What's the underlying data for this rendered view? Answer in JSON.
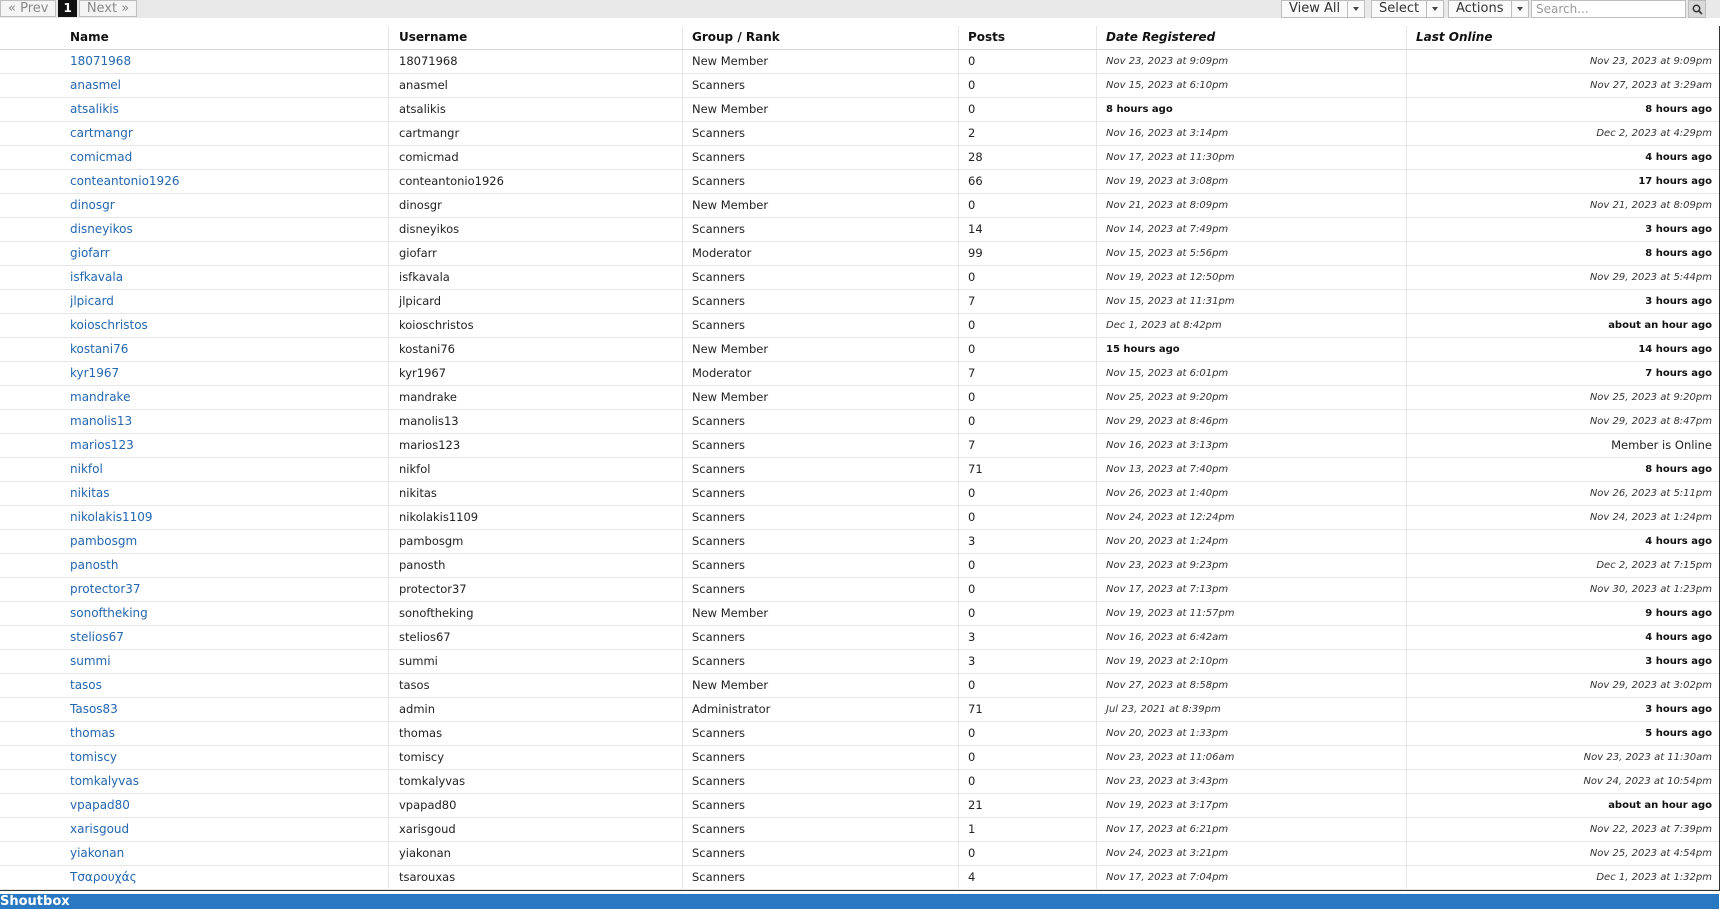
{
  "pager": {
    "prev": "« Prev",
    "current": "1",
    "next": "Next »"
  },
  "controls": {
    "view_all": "View All",
    "select": "Select",
    "actions": "Actions",
    "search_placeholder": "Search..."
  },
  "columns": [
    "Name",
    "Username",
    "Group / Rank",
    "Posts",
    "Date Registered",
    "Last Online"
  ],
  "rows": [
    {
      "name": "18071968",
      "username": "18071968",
      "group": "New Member",
      "posts": "0",
      "registered": "Nov 23, 2023 at 9:09pm",
      "last": "Nov 23, 2023 at 9:09pm"
    },
    {
      "name": "anasmel",
      "username": "anasmel",
      "group": "Scanners",
      "posts": "0",
      "registered": "Nov 15, 2023 at 6:10pm",
      "last": "Nov 27, 2023 at 3:29am"
    },
    {
      "name": "atsalikis",
      "username": "atsalikis",
      "group": "New Member",
      "posts": "0",
      "registered": "8 hours ago",
      "last": "8 hours ago"
    },
    {
      "name": "cartmangr",
      "username": "cartmangr",
      "group": "Scanners",
      "posts": "2",
      "registered": "Nov 16, 2023 at 3:14pm",
      "last": "Dec 2, 2023 at 4:29pm"
    },
    {
      "name": "comicmad",
      "username": "comicmad",
      "group": "Scanners",
      "posts": "28",
      "registered": "Nov 17, 2023 at 11:30pm",
      "last": "4 hours ago"
    },
    {
      "name": "conteantonio1926",
      "username": "conteantonio1926",
      "group": "Scanners",
      "posts": "66",
      "registered": "Nov 19, 2023 at 3:08pm",
      "last": "17 hours ago"
    },
    {
      "name": "dinosgr",
      "username": "dinosgr",
      "group": "New Member",
      "posts": "0",
      "registered": "Nov 21, 2023 at 8:09pm",
      "last": "Nov 21, 2023 at 8:09pm"
    },
    {
      "name": "disneyikos",
      "username": "disneyikos",
      "group": "Scanners",
      "posts": "14",
      "registered": "Nov 14, 2023 at 7:49pm",
      "last": "3 hours ago"
    },
    {
      "name": "giofarr",
      "username": "giofarr",
      "group": "Moderator",
      "posts": "99",
      "registered": "Nov 15, 2023 at 5:56pm",
      "last": "8 hours ago"
    },
    {
      "name": "isfkavala",
      "username": "isfkavala",
      "group": "Scanners",
      "posts": "0",
      "registered": "Nov 19, 2023 at 12:50pm",
      "last": "Nov 29, 2023 at 5:44pm"
    },
    {
      "name": "jlpicard",
      "username": "jlpicard",
      "group": "Scanners",
      "posts": "7",
      "registered": "Nov 15, 2023 at 11:31pm",
      "last": "3 hours ago"
    },
    {
      "name": "koioschristos",
      "username": "koioschristos",
      "group": "Scanners",
      "posts": "0",
      "registered": "Dec 1, 2023 at 8:42pm",
      "last": "about an hour ago"
    },
    {
      "name": "kostani76",
      "username": "kostani76",
      "group": "New Member",
      "posts": "0",
      "registered": "15 hours ago",
      "last": "14 hours ago"
    },
    {
      "name": "kyr1967",
      "username": "kyr1967",
      "group": "Moderator",
      "posts": "7",
      "registered": "Nov 15, 2023 at 6:01pm",
      "last": "7 hours ago"
    },
    {
      "name": "mandrake",
      "username": "mandrake",
      "group": "New Member",
      "posts": "0",
      "registered": "Nov 25, 2023 at 9:20pm",
      "last": "Nov 25, 2023 at 9:20pm"
    },
    {
      "name": "manolis13",
      "username": "manolis13",
      "group": "Scanners",
      "posts": "0",
      "registered": "Nov 29, 2023 at 8:46pm",
      "last": "Nov 29, 2023 at 8:47pm"
    },
    {
      "name": "marios123",
      "username": "marios123",
      "group": "Scanners",
      "posts": "7",
      "registered": "Nov 16, 2023 at 3:13pm",
      "last": "Member is Online"
    },
    {
      "name": "nikfol",
      "username": "nikfol",
      "group": "Scanners",
      "posts": "71",
      "registered": "Nov 13, 2023 at 7:40pm",
      "last": "8 hours ago"
    },
    {
      "name": "nikitas",
      "username": "nikitas",
      "group": "Scanners",
      "posts": "0",
      "registered": "Nov 26, 2023 at 1:40pm",
      "last": "Nov 26, 2023 at 5:11pm"
    },
    {
      "name": "nikolakis1109",
      "username": "nikolakis1109",
      "group": "Scanners",
      "posts": "0",
      "registered": "Nov 24, 2023 at 12:24pm",
      "last": "Nov 24, 2023 at 1:24pm"
    },
    {
      "name": "pambosgm",
      "username": "pambosgm",
      "group": "Scanners",
      "posts": "3",
      "registered": "Nov 20, 2023 at 1:24pm",
      "last": "4 hours ago"
    },
    {
      "name": "panosth",
      "username": "panosth",
      "group": "Scanners",
      "posts": "0",
      "registered": "Nov 23, 2023 at 9:23pm",
      "last": "Dec 2, 2023 at 7:15pm"
    },
    {
      "name": "protector37",
      "username": "protector37",
      "group": "Scanners",
      "posts": "0",
      "registered": "Nov 17, 2023 at 7:13pm",
      "last": "Nov 30, 2023 at 1:23pm"
    },
    {
      "name": "sonoftheking",
      "username": "sonoftheking",
      "group": "New Member",
      "posts": "0",
      "registered": "Nov 19, 2023 at 11:57pm",
      "last": "9 hours ago"
    },
    {
      "name": "stelios67",
      "username": "stelios67",
      "group": "Scanners",
      "posts": "3",
      "registered": "Nov 16, 2023 at 6:42am",
      "last": "4 hours ago"
    },
    {
      "name": "summi",
      "username": "summi",
      "group": "Scanners",
      "posts": "3",
      "registered": "Nov 19, 2023 at 2:10pm",
      "last": "3 hours ago"
    },
    {
      "name": "tasos",
      "username": "tasos",
      "group": "New Member",
      "posts": "0",
      "registered": "Nov 27, 2023 at 8:58pm",
      "last": "Nov 29, 2023 at 3:02pm"
    },
    {
      "name": "Tasos83",
      "username": "admin",
      "group": "Administrator",
      "posts": "71",
      "registered": "Jul 23, 2021 at 8:39pm",
      "last": "3 hours ago"
    },
    {
      "name": "thomas",
      "username": "thomas",
      "group": "Scanners",
      "posts": "0",
      "registered": "Nov 20, 2023 at 1:33pm",
      "last": "5 hours ago"
    },
    {
      "name": "tomiscy",
      "username": "tomiscy",
      "group": "Scanners",
      "posts": "0",
      "registered": "Nov 23, 2023 at 11:06am",
      "last": "Nov 23, 2023 at 11:30am"
    },
    {
      "name": "tomkalyvas",
      "username": "tomkalyvas",
      "group": "Scanners",
      "posts": "0",
      "registered": "Nov 23, 2023 at 3:43pm",
      "last": "Nov 24, 2023 at 10:54pm"
    },
    {
      "name": "vpapad80",
      "username": "vpapad80",
      "group": "Scanners",
      "posts": "21",
      "registered": "Nov 19, 2023 at 3:17pm",
      "last": "about an hour ago"
    },
    {
      "name": "xarisgoud",
      "username": "xarisgoud",
      "group": "Scanners",
      "posts": "1",
      "registered": "Nov 17, 2023 at 6:21pm",
      "last": "Nov 22, 2023 at 7:39pm"
    },
    {
      "name": "yiakonan",
      "username": "yiakonan",
      "group": "Scanners",
      "posts": "0",
      "registered": "Nov 24, 2023 at 3:21pm",
      "last": "Nov 25, 2023 at 4:54pm"
    },
    {
      "name": "Τσαρουχάς",
      "username": "tsarouxas",
      "group": "Scanners",
      "posts": "4",
      "registered": "Nov 17, 2023 at 7:04pm",
      "last": "Dec 1, 2023 at 1:32pm"
    }
  ],
  "shoutbox": {
    "title": "Shoutbox"
  },
  "colors": {
    "link": "#2467b0",
    "shoutbox_bg": "#2a78c1"
  }
}
